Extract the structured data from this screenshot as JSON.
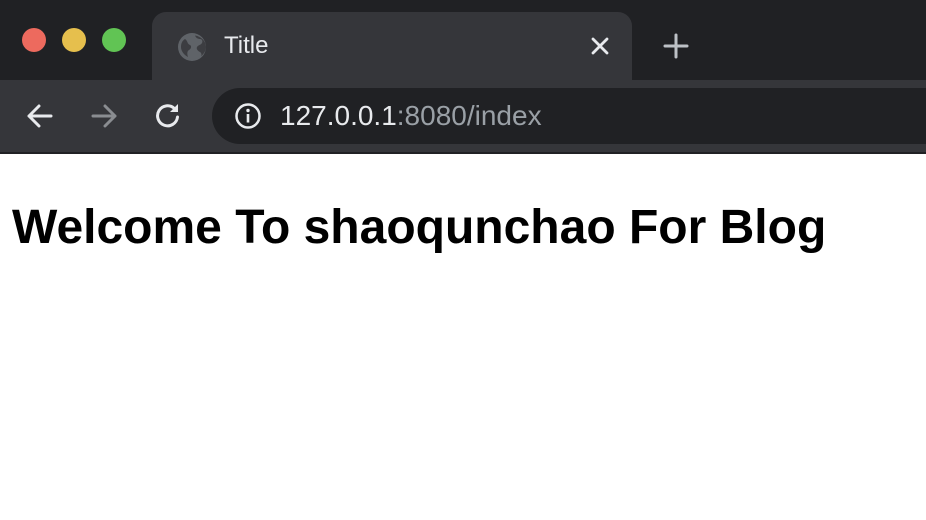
{
  "window": {
    "traffic_lights": {
      "close_color": "#ed6a5e",
      "minimize_color": "#e6bf4d",
      "maximize_color": "#61c454"
    }
  },
  "tab": {
    "title": "Title",
    "icon": "globe-icon",
    "close_icon": "close-icon"
  },
  "new_tab_icon": "plus-icon",
  "toolbar": {
    "back_icon": "arrow-left-icon",
    "forward_icon": "arrow-right-icon",
    "reload_icon": "reload-icon"
  },
  "address_bar": {
    "info_icon": "info-icon",
    "url_host": "127.0.0.1",
    "url_rest": ":8080/index"
  },
  "page": {
    "heading": "Welcome To shaoqunchao For Blog"
  },
  "colors": {
    "tabstrip_bg": "#202124",
    "toolbar_bg": "#35363a",
    "omnibox_bg": "#202124",
    "text_primary": "#e8eaed",
    "text_muted": "#9aa0a6",
    "page_bg": "#ffffff"
  }
}
